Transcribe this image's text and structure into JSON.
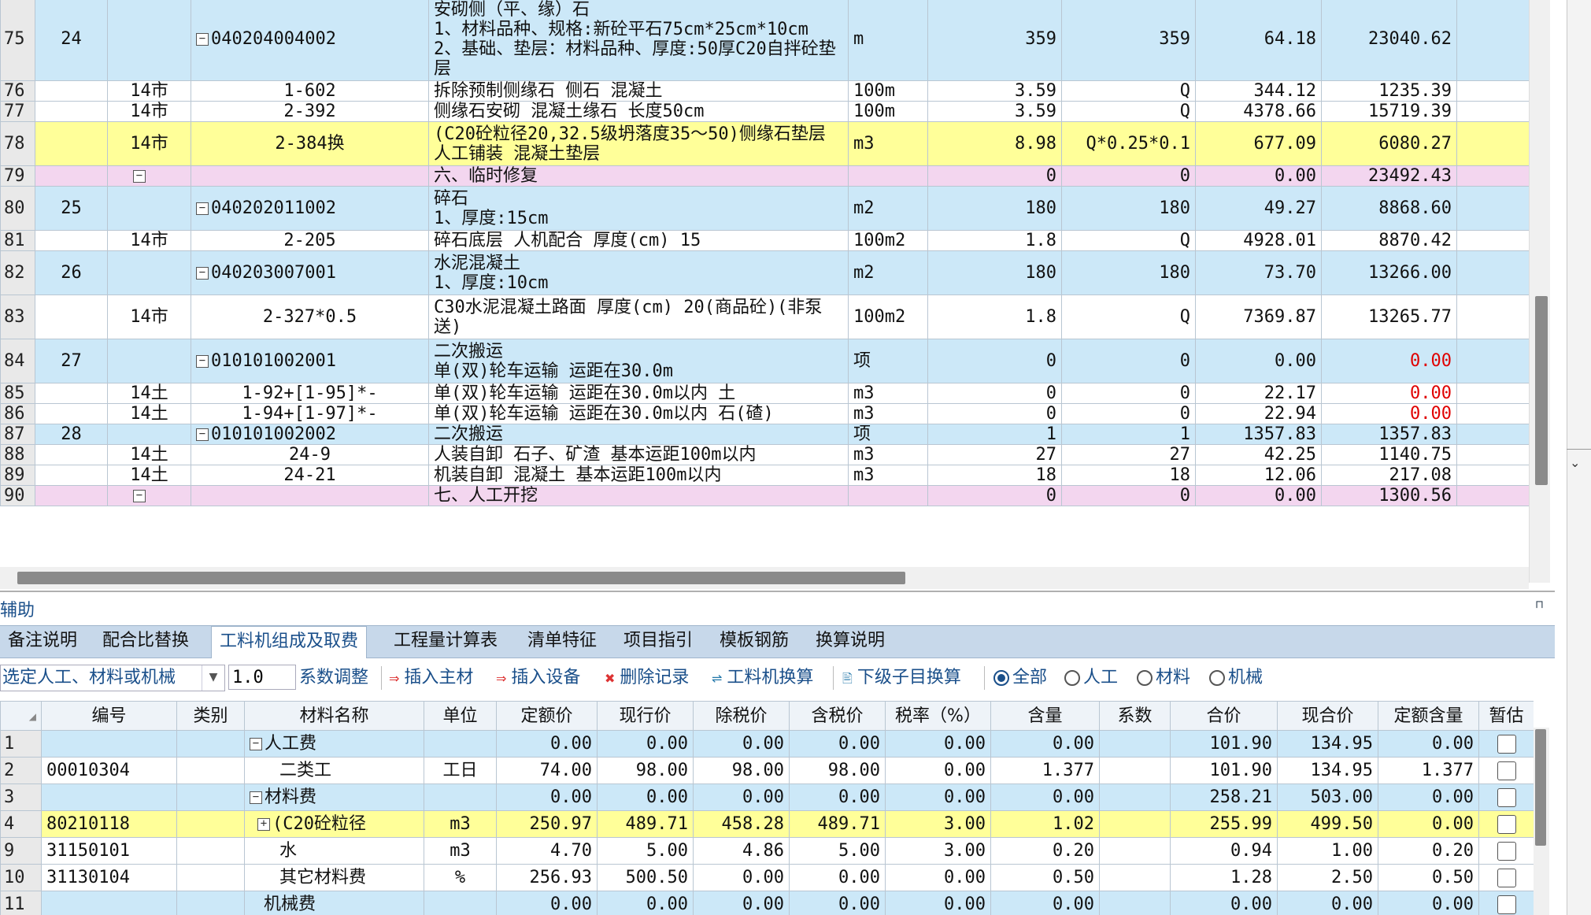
{
  "top_grid": {
    "rows": [
      {
        "rn": "75",
        "seq": "24",
        "cat": "",
        "toggle": "minus",
        "code": "040204004002",
        "name": "安砌侧（平、缘）石\n1、材料品种、规格:新砼平石75cm*25cm*10cm\n2、基础、垫层：材料品种、厚度:50厚C20自拌砼垫层",
        "unit": "m",
        "qty": "359",
        "expr": "359",
        "price": "64.18",
        "total": "23040.62",
        "tint": "blue",
        "total_red": false
      },
      {
        "rn": "76",
        "seq": "",
        "cat": "14市",
        "toggle": "",
        "code": "1-602",
        "name": "拆除预制侧缘石 侧石 混凝土",
        "unit": "100m",
        "qty": "3.59",
        "expr": "Q",
        "price": "344.12",
        "total": "1235.39",
        "tint": "white",
        "total_red": false
      },
      {
        "rn": "77",
        "seq": "",
        "cat": "14市",
        "toggle": "",
        "code": "2-392",
        "name": "侧缘石安砌 混凝土缘石 长度50cm",
        "unit": "100m",
        "qty": "3.59",
        "expr": "Q",
        "price": "4378.66",
        "total": "15719.39",
        "tint": "white",
        "total_red": false
      },
      {
        "rn": "78",
        "seq": "",
        "cat": "14市",
        "toggle": "",
        "code": "2-384换",
        "name": "(C20砼粒径20,32.5级坍落度35～50)侧缘石垫层 人工铺装 混凝土垫层",
        "unit": "m3",
        "qty": "8.98",
        "expr": "Q*0.25*0.1",
        "price": "677.09",
        "total": "6080.27",
        "tint": "yellow",
        "total_red": false
      },
      {
        "rn": "79",
        "seq": "",
        "cat": "",
        "toggle": "minus-left",
        "code": "",
        "name": "六、临时修复",
        "unit": "",
        "qty": "0",
        "expr": "0",
        "price": "0.00",
        "total": "23492.43",
        "tint": "pink",
        "total_red": false
      },
      {
        "rn": "80",
        "seq": "25",
        "cat": "",
        "toggle": "minus",
        "code": "040202011002",
        "name": "碎石\n1、厚度:15cm",
        "unit": "m2",
        "qty": "180",
        "expr": "180",
        "price": "49.27",
        "total": "8868.60",
        "tint": "blue",
        "total_red": false
      },
      {
        "rn": "81",
        "seq": "",
        "cat": "14市",
        "toggle": "",
        "code": "2-205",
        "name": "碎石底层 人机配合 厚度(cm) 15",
        "unit": "100m2",
        "qty": "1.8",
        "expr": "Q",
        "price": "4928.01",
        "total": "8870.42",
        "tint": "white",
        "total_red": false
      },
      {
        "rn": "82",
        "seq": "26",
        "cat": "",
        "toggle": "minus",
        "code": "040203007001",
        "name": "水泥混凝土\n1、厚度:10cm",
        "unit": "m2",
        "qty": "180",
        "expr": "180",
        "price": "73.70",
        "total": "13266.00",
        "tint": "blue",
        "total_red": false
      },
      {
        "rn": "83",
        "seq": "",
        "cat": "14市",
        "toggle": "",
        "code": "2-327*0.5",
        "name": "C30水泥混凝土路面 厚度(cm) 20(商品砼)(非泵送)",
        "unit": "100m2",
        "qty": "1.8",
        "expr": "Q",
        "price": "7369.87",
        "total": "13265.77",
        "tint": "white",
        "total_red": false
      },
      {
        "rn": "84",
        "seq": "27",
        "cat": "",
        "toggle": "minus",
        "code": "010101002001",
        "name": "二次搬运\n单(双)轮车运输 运距在30.0m",
        "unit": "项",
        "qty": "0",
        "expr": "0",
        "price": "0.00",
        "total": "0.00",
        "tint": "blue",
        "total_red": true
      },
      {
        "rn": "85",
        "seq": "",
        "cat": "14土",
        "toggle": "",
        "code": "1-92+[1-95]*-",
        "name": "单(双)轮车运输 运距在30.0m以内 土",
        "unit": "m3",
        "qty": "0",
        "expr": "0",
        "price": "22.17",
        "total": "0.00",
        "tint": "white",
        "total_red": true
      },
      {
        "rn": "86",
        "seq": "",
        "cat": "14土",
        "toggle": "",
        "code": "1-94+[1-97]*-",
        "name": "单(双)轮车运输 运距在30.0m以内 石(碴)",
        "unit": "m3",
        "qty": "0",
        "expr": "0",
        "price": "22.94",
        "total": "0.00",
        "tint": "white",
        "total_red": true
      },
      {
        "rn": "87",
        "seq": "28",
        "cat": "",
        "toggle": "minus",
        "code": "010101002002",
        "name": "二次搬运",
        "unit": "项",
        "qty": "1",
        "expr": "1",
        "price": "1357.83",
        "total": "1357.83",
        "tint": "blue",
        "total_red": false
      },
      {
        "rn": "88",
        "seq": "",
        "cat": "14土",
        "toggle": "",
        "code": "24-9",
        "name": "人装自卸 石子、矿渣 基本运距100m以内",
        "unit": "m3",
        "qty": "27",
        "expr": "27",
        "price": "42.25",
        "total": "1140.75",
        "tint": "white",
        "total_red": false
      },
      {
        "rn": "89",
        "seq": "",
        "cat": "14土",
        "toggle": "",
        "code": "24-21",
        "name": "机装自卸 混凝土 基本运距100m以内",
        "unit": "m3",
        "qty": "18",
        "expr": "18",
        "price": "12.06",
        "total": "217.08",
        "tint": "white",
        "total_red": false
      },
      {
        "rn": "90",
        "seq": "",
        "cat": "",
        "toggle": "minus-left",
        "code": "",
        "name": "七、人工开挖",
        "unit": "",
        "qty": "0",
        "expr": "0",
        "price": "0.00",
        "total": "1300.56",
        "tint": "pink",
        "total_red": false
      }
    ]
  },
  "aux": {
    "title": "辅助",
    "tabs": [
      "备注说明",
      "配合比替换",
      "工料机组成及取费",
      "工程量计算表",
      "清单特征",
      "项目指引",
      "模板钢筋",
      "换算说明"
    ],
    "active_tab": "工料机组成及取费"
  },
  "toolbar": {
    "select_label": "选定人工、材料或机械",
    "coef_value": "1.0",
    "coef_adjust": "系数调整",
    "insert_main": "插入主材",
    "insert_equip": "插入设备",
    "delete_record": "删除记录",
    "lgj_swap": "工料机换算",
    "sub_swap": "下级子目换算",
    "radio_all": "全部",
    "radio_labor": "人工",
    "radio_material": "材料",
    "radio_machine": "机械"
  },
  "bottom_grid": {
    "headers": [
      "编号",
      "类别",
      "材料名称",
      "单位",
      "定额价",
      "现行价",
      "除税价",
      "含税价",
      "税率（%）",
      "含量",
      "系数",
      "合价",
      "现合价",
      "定额含量",
      "暂估"
    ],
    "rows": [
      {
        "rn": "1",
        "code": "",
        "cat": "",
        "toggle": "minus",
        "name": "人工费",
        "unit": "",
        "p1": "0.00",
        "p2": "0.00",
        "p3": "0.00",
        "p4": "0.00",
        "tax": "0.00",
        "amt": "0.00",
        "coef": "",
        "sum": "101.90",
        "sum2": "134.95",
        "qamt": "0.00",
        "tint": "blue"
      },
      {
        "rn": "2",
        "code": "00010304",
        "cat": "",
        "toggle": "",
        "name": "二类工",
        "unit": "工日",
        "p1": "74.00",
        "p2": "98.00",
        "p3": "98.00",
        "p4": "98.00",
        "tax": "0.00",
        "amt": "1.377",
        "coef": "",
        "sum": "101.90",
        "sum2": "134.95",
        "qamt": "1.377",
        "tint": "white"
      },
      {
        "rn": "3",
        "code": "",
        "cat": "",
        "toggle": "minus",
        "name": "材料费",
        "unit": "",
        "p1": "0.00",
        "p2": "0.00",
        "p3": "0.00",
        "p4": "0.00",
        "tax": "0.00",
        "amt": "0.00",
        "coef": "",
        "sum": "258.21",
        "sum2": "503.00",
        "qamt": "0.00",
        "tint": "blue"
      },
      {
        "rn": "4",
        "code": "80210118",
        "cat": "",
        "toggle": "plus",
        "name": "(C20砼粒径",
        "unit": "m3",
        "p1": "250.97",
        "p2": "489.71",
        "p3": "458.28",
        "p4": "489.71",
        "tax": "3.00",
        "amt": "1.02",
        "coef": "",
        "sum": "255.99",
        "sum2": "499.50",
        "qamt": "0.00",
        "tint": "yellow"
      },
      {
        "rn": "9",
        "code": "31150101",
        "cat": "",
        "toggle": "",
        "name": "水",
        "unit": "m3",
        "p1": "4.70",
        "p2": "5.00",
        "p3": "4.86",
        "p4": "5.00",
        "tax": "3.00",
        "amt": "0.20",
        "coef": "",
        "sum": "0.94",
        "sum2": "1.00",
        "qamt": "0.20",
        "tint": "white"
      },
      {
        "rn": "10",
        "code": "31130104",
        "cat": "",
        "toggle": "",
        "name": "其它材料费",
        "unit": "%",
        "p1": "256.93",
        "p2": "500.50",
        "p3": "0.00",
        "p4": "0.00",
        "tax": "0.00",
        "amt": "0.50",
        "coef": "",
        "sum": "1.28",
        "sum2": "2.50",
        "qamt": "0.50",
        "tint": "white"
      },
      {
        "rn": "11",
        "code": "",
        "cat": "",
        "toggle": "none-indent",
        "name": "机械费",
        "unit": "",
        "p1": "0.00",
        "p2": "0.00",
        "p3": "0.00",
        "p4": "0.00",
        "tax": "0.00",
        "amt": "0.00",
        "coef": "",
        "sum": "0.00",
        "sum2": "0.00",
        "qamt": "0.00",
        "tint": "blue"
      }
    ]
  }
}
